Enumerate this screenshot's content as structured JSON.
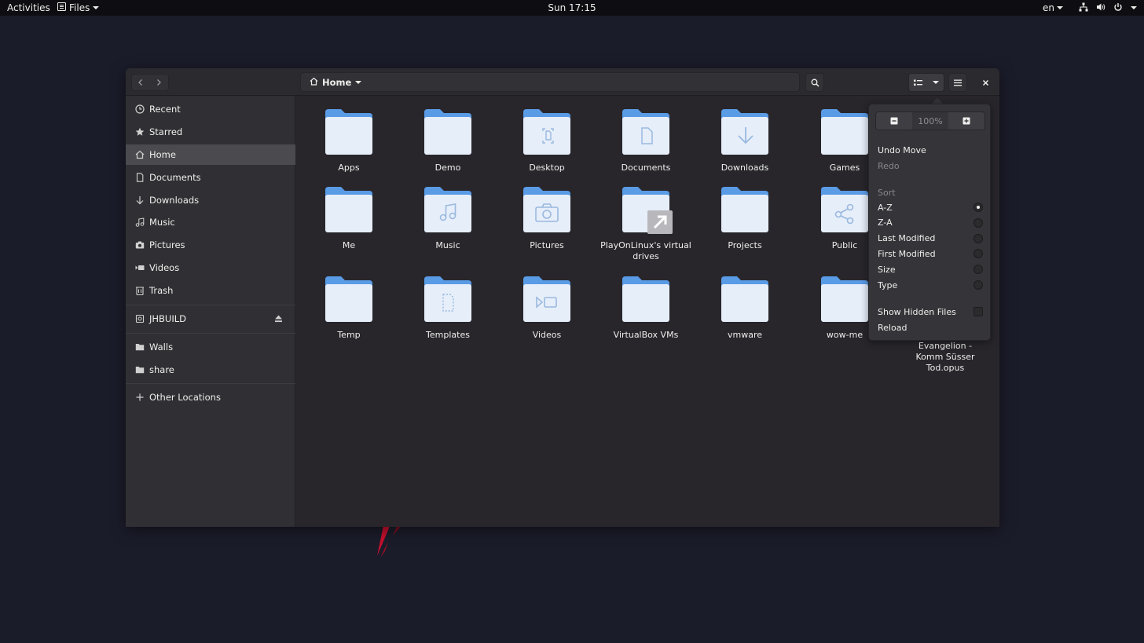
{
  "topbar": {
    "activities": "Activities",
    "app_menu": "Files",
    "clock": "Sun 17:15",
    "language": "en"
  },
  "pathbar": {
    "location": "Home"
  },
  "sidebar": {
    "items": [
      {
        "label": "Recent",
        "icon": "clock-icon"
      },
      {
        "label": "Starred",
        "icon": "star-icon"
      },
      {
        "label": "Home",
        "icon": "home-icon",
        "active": true
      },
      {
        "label": "Documents",
        "icon": "document-icon"
      },
      {
        "label": "Downloads",
        "icon": "download-icon"
      },
      {
        "label": "Music",
        "icon": "music-icon"
      },
      {
        "label": "Pictures",
        "icon": "camera-icon"
      },
      {
        "label": "Videos",
        "icon": "video-icon"
      },
      {
        "label": "Trash",
        "icon": "trash-icon"
      }
    ],
    "devices": [
      {
        "label": "JHBUILD",
        "icon": "drive-icon"
      }
    ],
    "bookmarks": [
      {
        "label": "Walls",
        "icon": "folder-icon"
      },
      {
        "label": "share",
        "icon": "folder-icon"
      }
    ],
    "other": {
      "label": "Other Locations",
      "icon": "plus-icon"
    }
  },
  "files": [
    {
      "label": "Apps",
      "emblem": "none"
    },
    {
      "label": "Demo",
      "emblem": "none"
    },
    {
      "label": "Desktop",
      "emblem": "desktop"
    },
    {
      "label": "Documents",
      "emblem": "document"
    },
    {
      "label": "Downloads",
      "emblem": "download"
    },
    {
      "label": "Games",
      "emblem": "none"
    },
    {
      "label": "Me",
      "emblem": "none"
    },
    {
      "label": "Music",
      "emblem": "music"
    },
    {
      "label": "Pictures",
      "emblem": "camera"
    },
    {
      "label": "PlayOnLinux's virtual drives",
      "emblem": "symlink"
    },
    {
      "label": "Projects",
      "emblem": "none"
    },
    {
      "label": "Public",
      "emblem": "share"
    },
    {
      "label": "Temp",
      "emblem": "none"
    },
    {
      "label": "Templates",
      "emblem": "template"
    },
    {
      "label": "Videos",
      "emblem": "video"
    },
    {
      "label": "VirtualBox VMs",
      "emblem": "none"
    },
    {
      "label": "vmware",
      "emblem": "none"
    },
    {
      "label": "wow-me",
      "emblem": "none"
    }
  ],
  "partial_file_label": "Evangelion - Komm Süsser Tod.opus",
  "view_menu": {
    "zoom": "100%",
    "undo": "Undo Move",
    "redo": "Redo",
    "sort_header": "Sort",
    "sort_options": [
      "A-Z",
      "Z-A",
      "Last Modified",
      "First Modified",
      "Size",
      "Type"
    ],
    "sort_selected": "A-Z",
    "show_hidden": "Show Hidden Files",
    "reload": "Reload"
  },
  "colors": {
    "folder_body": "#e6eefa",
    "folder_tab": "#5a9be6",
    "emblem": "#9ab9de",
    "accent_red": "#c8102e"
  }
}
